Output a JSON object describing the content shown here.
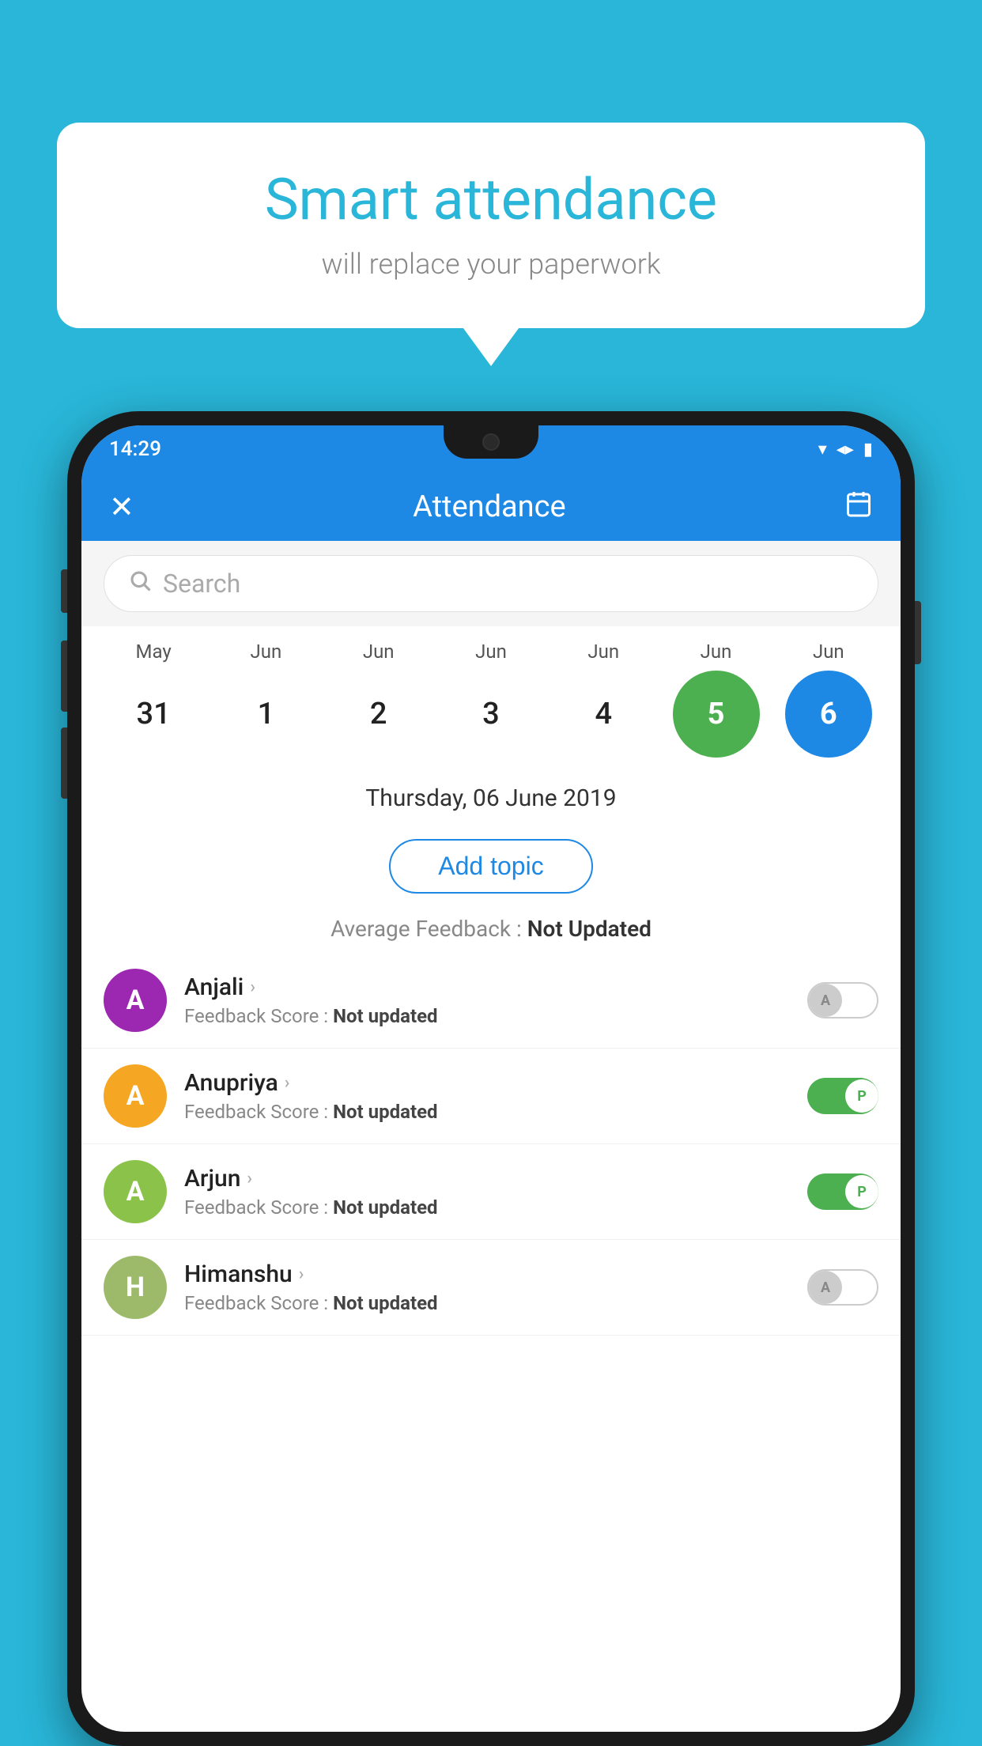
{
  "background_color": "#29b6d8",
  "speech_bubble": {
    "title": "Smart attendance",
    "subtitle": "will replace your paperwork"
  },
  "status_bar": {
    "time": "14:29",
    "wifi_icon": "▼",
    "signal_icon": "▲",
    "battery_icon": "▮"
  },
  "app_header": {
    "close_label": "✕",
    "title": "Attendance",
    "calendar_icon": "📅"
  },
  "search": {
    "placeholder": "Search"
  },
  "calendar": {
    "months": [
      "May",
      "Jun",
      "Jun",
      "Jun",
      "Jun",
      "Jun",
      "Jun"
    ],
    "days": [
      "31",
      "1",
      "2",
      "3",
      "4",
      "5",
      "6"
    ],
    "selected_date_label": "Thursday, 06 June 2019",
    "day_5_state": "today-green",
    "day_6_state": "today-blue"
  },
  "add_topic": {
    "label": "Add topic"
  },
  "avg_feedback": {
    "label": "Average Feedback : ",
    "value": "Not Updated"
  },
  "students": [
    {
      "name": "Anjali",
      "avatar_letter": "A",
      "avatar_color": "#9c27b0",
      "feedback_label": "Feedback Score : ",
      "feedback_value": "Not updated",
      "toggle_state": "off",
      "toggle_label": "A"
    },
    {
      "name": "Anupriya",
      "avatar_letter": "A",
      "avatar_color": "#f5a623",
      "feedback_label": "Feedback Score : ",
      "feedback_value": "Not updated",
      "toggle_state": "on",
      "toggle_label": "P"
    },
    {
      "name": "Arjun",
      "avatar_letter": "A",
      "avatar_color": "#8bc34a",
      "feedback_label": "Feedback Score : ",
      "feedback_value": "Not updated",
      "toggle_state": "on",
      "toggle_label": "P"
    },
    {
      "name": "Himanshu",
      "avatar_letter": "H",
      "avatar_color": "#9cba6a",
      "feedback_label": "Feedback Score : ",
      "feedback_value": "Not updated",
      "toggle_state": "off",
      "toggle_label": "A"
    }
  ]
}
